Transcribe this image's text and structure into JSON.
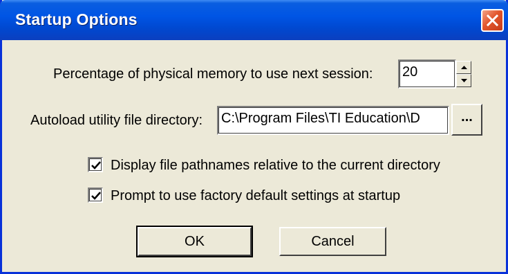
{
  "window": {
    "title": "Startup Options"
  },
  "memory": {
    "label": "Percentage of physical memory to use next session:",
    "value": "20"
  },
  "autoload": {
    "label": "Autoload utility file directory:",
    "value": "C:\\Program Files\\TI Education\\D",
    "browse_label": "..."
  },
  "options": [
    {
      "label": "Display file pathnames relative to the current directory",
      "checked": true
    },
    {
      "label": "Prompt to use factory default settings at startup",
      "checked": true
    }
  ],
  "buttons": {
    "ok": "OK",
    "cancel": "Cancel"
  },
  "colors": {
    "titlebar": "#0055e5",
    "close": "#e2562c",
    "dialog_bg": "#ece9d8"
  }
}
